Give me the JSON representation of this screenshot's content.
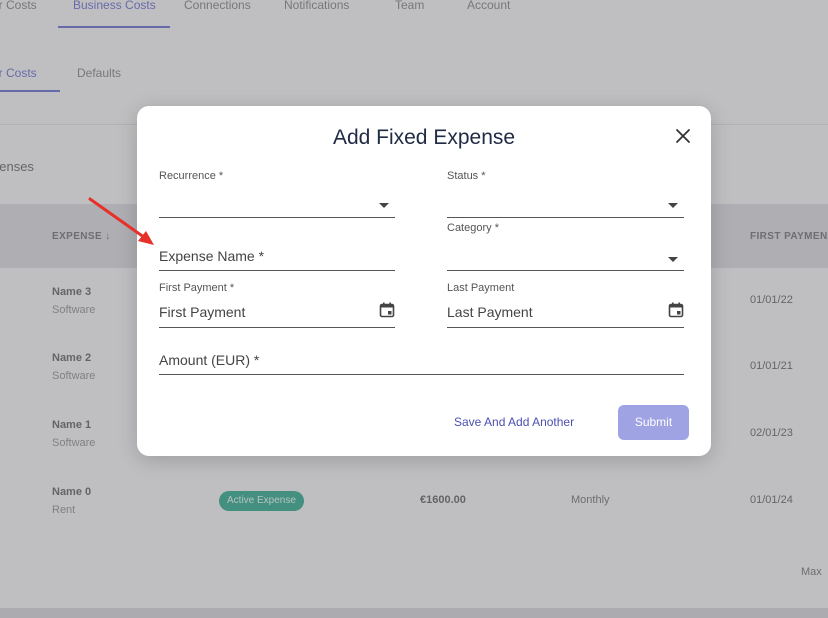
{
  "top_tabs": [
    "er Costs",
    "Business Costs",
    "Connections",
    "Notifications",
    "Team",
    "Account"
  ],
  "sub_tabs": [
    "er Costs",
    "Defaults"
  ],
  "section_label": "penses",
  "table": {
    "headers": [
      "EXPENSE ↓",
      "FIRST PAYMEN"
    ],
    "rows": [
      {
        "name": "Name 3",
        "category": "Software",
        "first_payment": "01/01/22"
      },
      {
        "name": "Name 2",
        "category": "Software",
        "first_payment": "01/01/21"
      },
      {
        "name": "Name 1",
        "category": "Software",
        "first_payment": "02/01/23"
      },
      {
        "name": "Name 0",
        "category": "Rent",
        "status": "Active Expense",
        "amount": "€1600.00",
        "frequency": "Monthly",
        "first_payment": "01/01/24"
      }
    ]
  },
  "max_label": "Max",
  "modal": {
    "title": "Add Fixed Expense",
    "fields": {
      "recurrence": {
        "label": "Recurrence *",
        "value": ""
      },
      "status": {
        "label": "Status *",
        "value": ""
      },
      "expense_name": {
        "label": "Expense Name *"
      },
      "category": {
        "label": "Category *",
        "value": ""
      },
      "first_payment": {
        "label": "First Payment *",
        "placeholder": "First Payment"
      },
      "last_payment": {
        "label": "Last Payment",
        "placeholder": "Last Payment"
      },
      "amount": {
        "label": "Amount (EUR) *"
      }
    },
    "save_another_label": "Save And Add Another",
    "submit_label": "Submit"
  },
  "colors": {
    "accent": "#5a5fd0",
    "submit_bg": "#9fa2e3",
    "badge_bg": "#1aa583",
    "annotation_arrow": "#e8302a"
  },
  "icons": [
    "close-icon",
    "calendar-icon",
    "dropdown-caret-icon"
  ]
}
